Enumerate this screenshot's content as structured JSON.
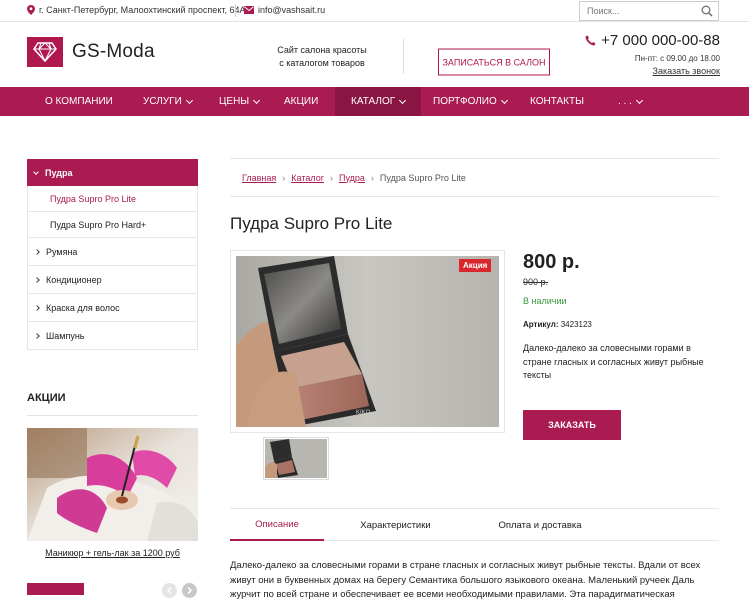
{
  "topbar": {
    "address": "г. Санкт-Петербург, Малоохтинский проспект, 64А",
    "email": "info@vashsait.ru",
    "search_placeholder": "Поиск..."
  },
  "header": {
    "logo_text": "GS-Moda",
    "tagline_line1": "Сайт салона красоты",
    "tagline_line2": "с каталогом товаров",
    "signup_label": "ЗАПИСАТЬСЯ В САЛОН",
    "phone": "+7 000 000-00-88",
    "hours": "Пн-пт: с 09.00 до 18.00",
    "callback": "Заказать звонок"
  },
  "nav": {
    "items": [
      {
        "label": "О КОМПАНИИ"
      },
      {
        "label": "УСЛУГИ"
      },
      {
        "label": "ЦЕНЫ"
      },
      {
        "label": "АКЦИИ"
      },
      {
        "label": "КАТАЛОГ"
      },
      {
        "label": "ПОРТФОЛИО"
      },
      {
        "label": "КОНТАКТЫ"
      },
      {
        "label": ". . ."
      }
    ]
  },
  "sidebar": {
    "active_category": "Пудра",
    "subitems": [
      "Пудра Supro Pro Lite",
      "Пудра Supro Pro Hard+"
    ],
    "categories": [
      "Румяна",
      "Кондиционер",
      "Краска для волос",
      "Шампунь"
    ]
  },
  "promo": {
    "title": "АКЦИИ",
    "caption": "Маникюр + гель-лак за 1200 руб"
  },
  "breadcrumb": {
    "items": [
      "Главная",
      "Каталог",
      "Пудра"
    ],
    "current": "Пудра Supro Pro Lite"
  },
  "product": {
    "title": "Пудра Supro Pro Lite",
    "badge": "Акция",
    "price": "800 р.",
    "old_price": "900 р.",
    "stock": "В наличии",
    "sku_label": "Артикул:",
    "sku_value": "3423123",
    "description": "Далеко-далеко за словесными горами в стране гласных и согласных живут рыбные тексты",
    "order_label": "ЗАКАЗАТЬ",
    "compact_brand": "KIKO"
  },
  "tabs": {
    "items": [
      "Описание",
      "Характеристики",
      "Оплата и доставка"
    ]
  },
  "body_text": "Далеко-далеко за словесными горами в стране гласных и согласных живут рыбные тексты. Вдали от всех живут они в буквенных домах на берегу Семантика большого языкового океана. Маленький ручеек Даль журчит по всей стране и обеспечивает ее всеми необходимыми правилами. Эта парадигматическая",
  "colors": {
    "accent": "#a91b51",
    "accent_dark": "#8b1542",
    "sale": "#d9272e",
    "stock": "#3a9a3a"
  }
}
